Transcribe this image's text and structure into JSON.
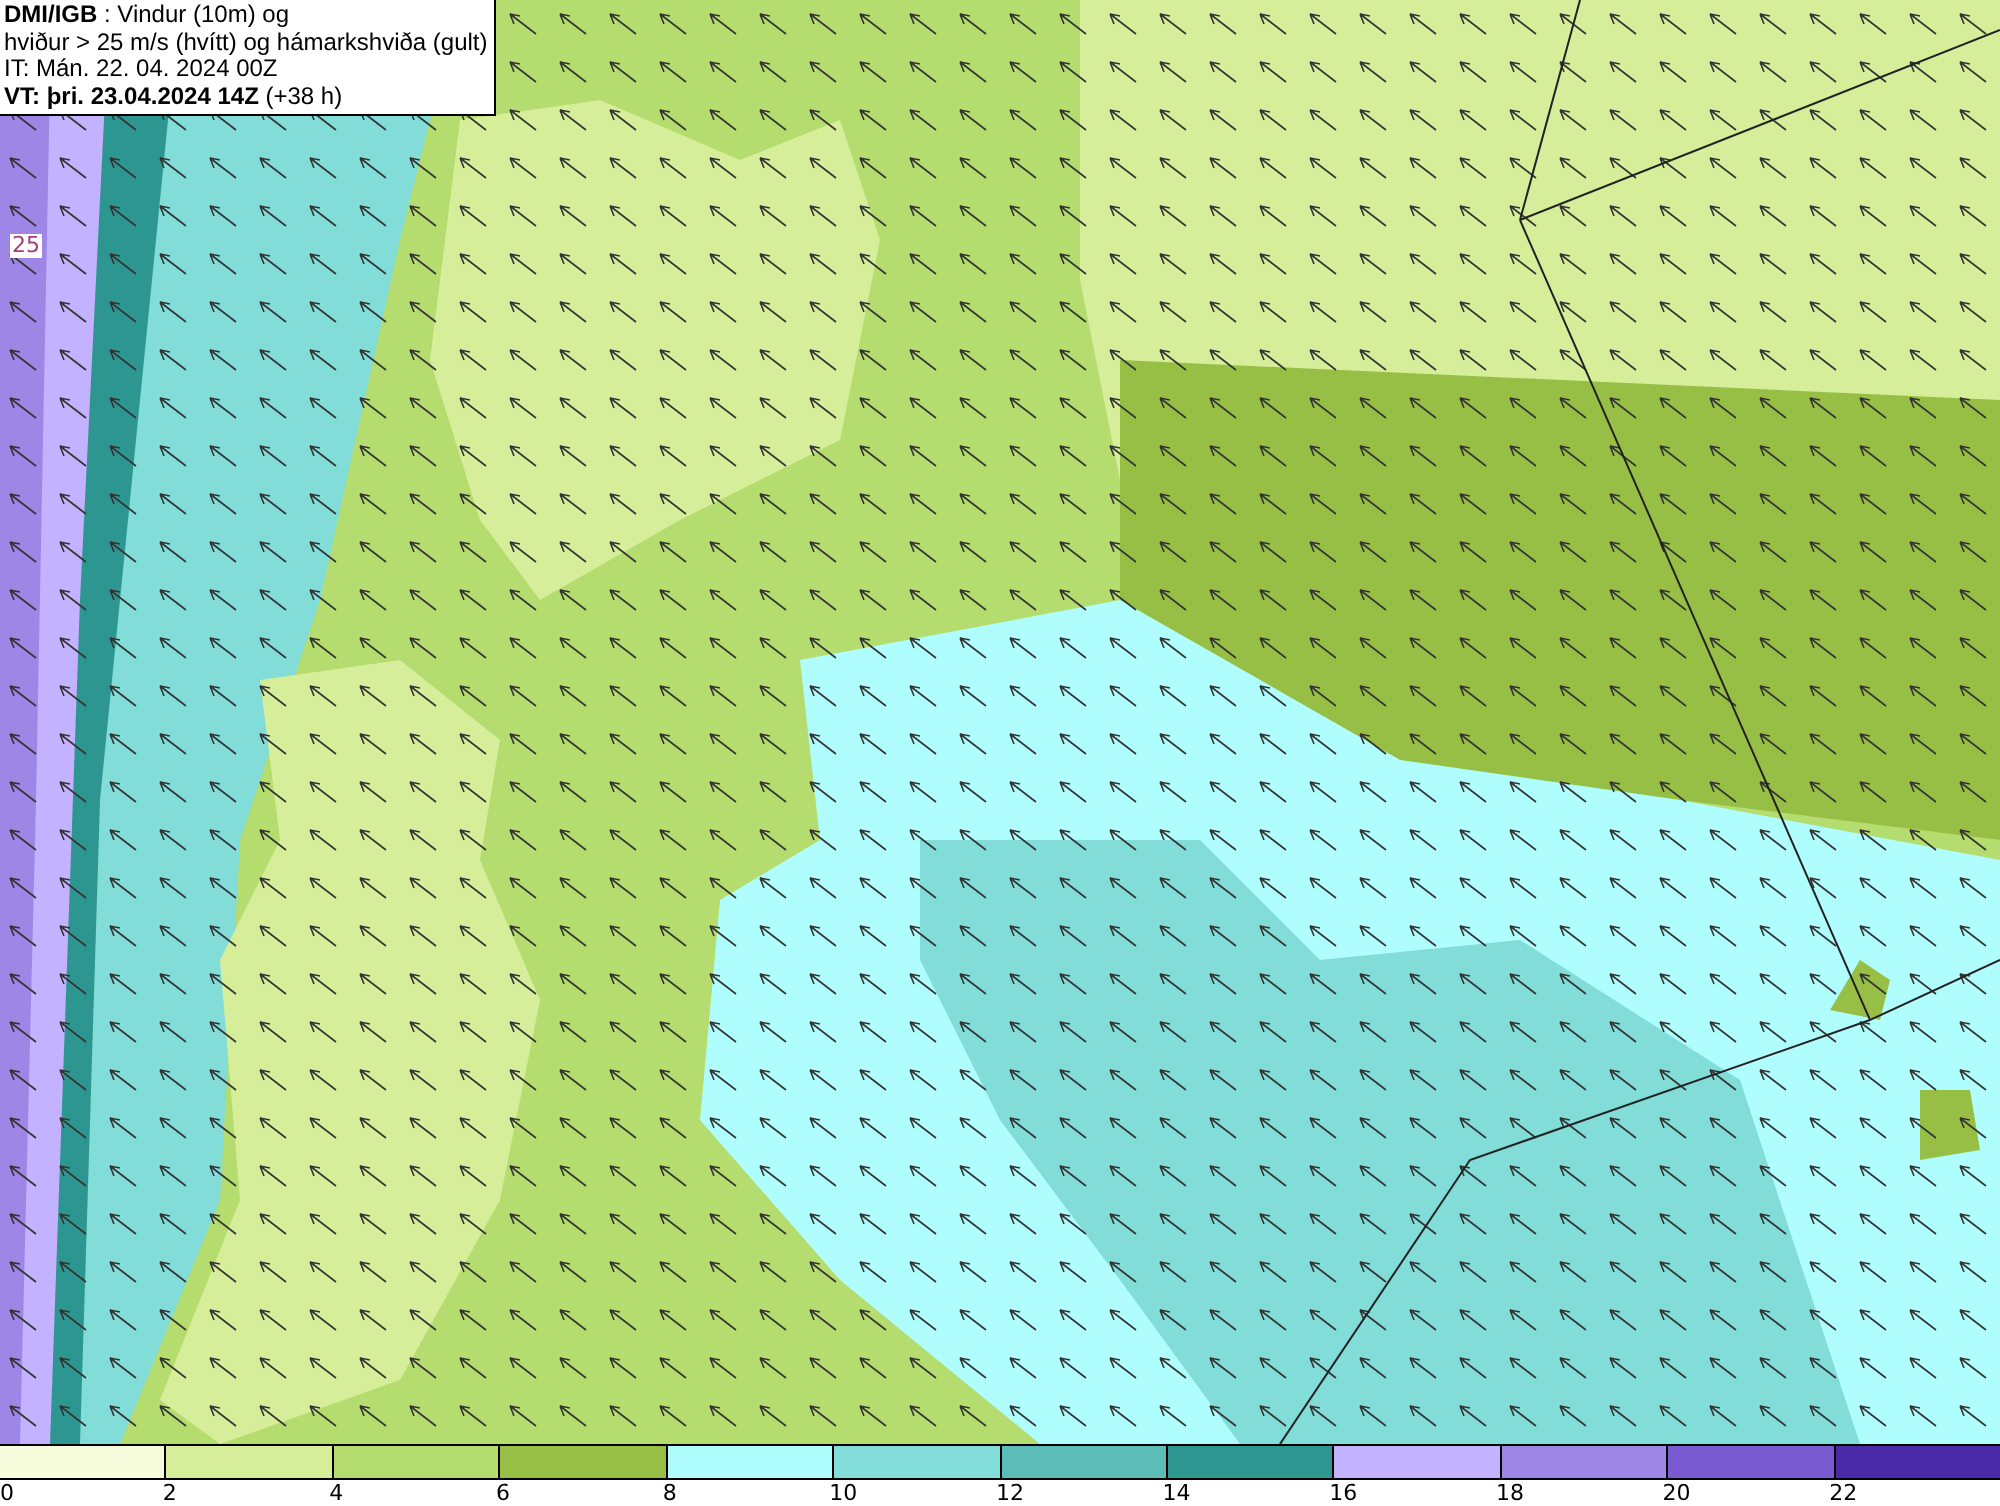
{
  "legend": {
    "brand": "DMI/IGB",
    "title": " : Vindur (10m) og",
    "line_2": "hviður > 25 m/s (hvítt) og hámarkshviða (gult)",
    "line_3": "IT: Mán. 22. 04. 2024 00Z",
    "valid_time": "VT: þri. 23.04.2024 14Z",
    "lead": " (+38 h)"
  },
  "map": {
    "contour_label": "25"
  },
  "colorbar": {
    "bins": [
      {
        "color": "#f7fcdc",
        "tick": "0"
      },
      {
        "color": "#d6ee9a",
        "tick": "2"
      },
      {
        "color": "#b5dc6e",
        "tick": "4"
      },
      {
        "color": "#97bf46",
        "tick": "6"
      },
      {
        "color": "#b0fdfe",
        "tick": "8"
      },
      {
        "color": "#82dcd8",
        "tick": "10"
      },
      {
        "color": "#5bbcb8",
        "tick": "12"
      },
      {
        "color": "#2e9690",
        "tick": "14"
      },
      {
        "color": "#c2b2ff",
        "tick": "16"
      },
      {
        "color": "#9d86e6",
        "tick": "18"
      },
      {
        "color": "#7a5ad0",
        "tick": "20"
      },
      {
        "color": "#4a2aa8",
        "tick": "22"
      }
    ]
  }
}
